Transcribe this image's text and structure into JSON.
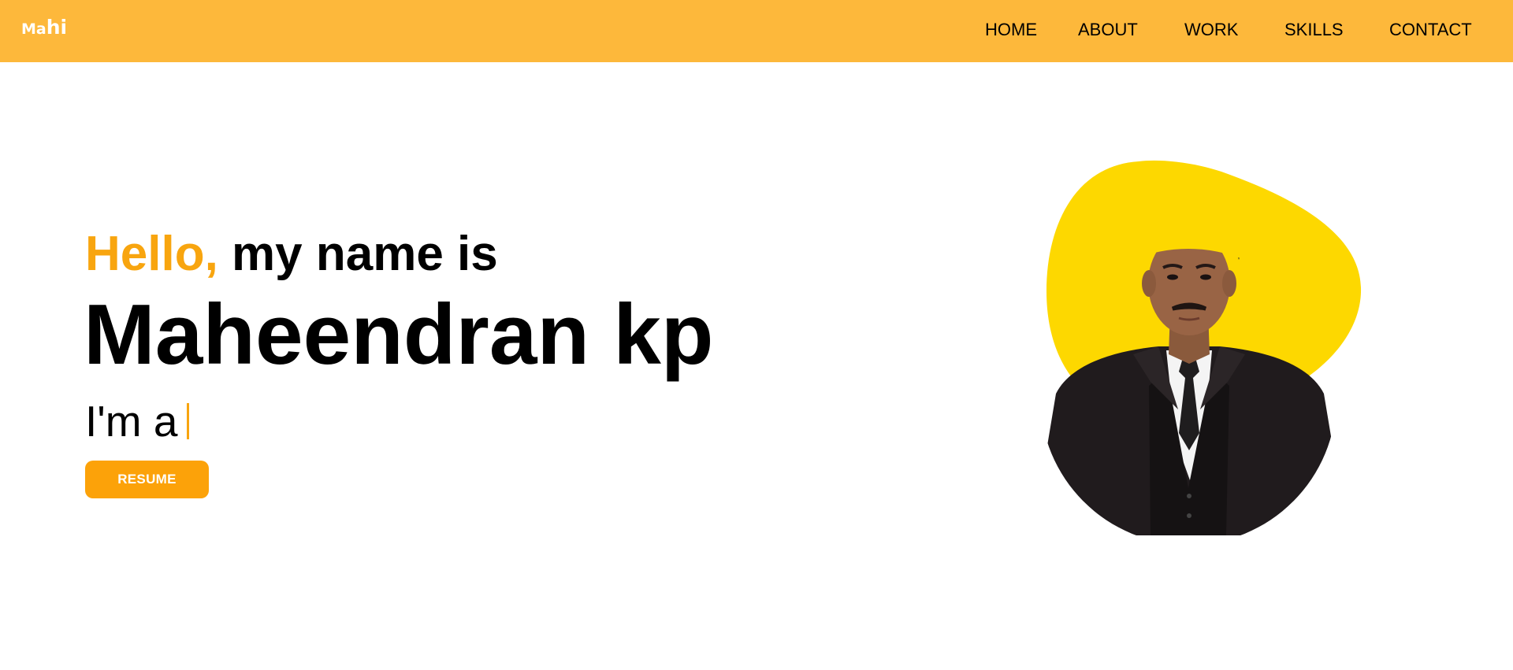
{
  "header": {
    "logo_small": "Ma",
    "logo_big": "hi",
    "nav": {
      "home": "HOME",
      "about": "ABOUT",
      "work": "WORK",
      "skills": "SKILLS",
      "contact": "CONTACT"
    }
  },
  "hero": {
    "hello": "Hello,",
    "greeting_rest": " my name is",
    "name": "Maheendran kp",
    "role_prefix": "I'm a",
    "resume_label": "RESUME"
  },
  "colors": {
    "nav_background": "#fdb83b",
    "accent": "#f8a50f",
    "blob": "#fdd800",
    "button": "#fca209"
  }
}
